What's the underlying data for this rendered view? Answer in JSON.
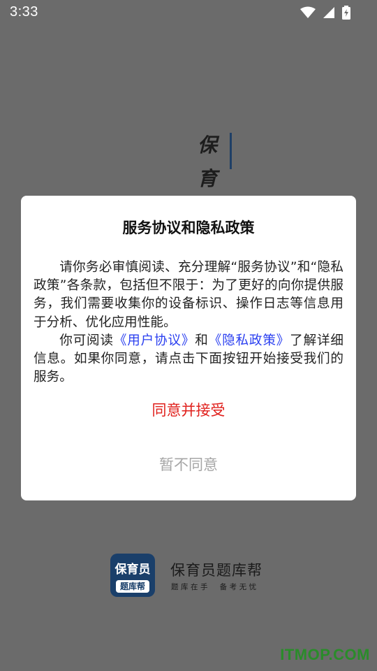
{
  "status_bar": {
    "time": "3:33",
    "icons": [
      "wifi-icon",
      "cellular-signal-icon",
      "battery-charging-icon"
    ]
  },
  "splash": {
    "chars": [
      "保",
      "育"
    ]
  },
  "dialog": {
    "title": "服务协议和隐私政策",
    "paragraph1": "请你务必审慎阅读、充分理解“服务协议”和“隐私政策”各条款，包括但不限于：为了更好的向你提供服务，我们需要收集你的设备标识、操作日志等信息用于分析、优化应用性能。",
    "paragraph2_prefix": "你可阅读",
    "user_agreement_link": "《用户协议》",
    "paragraph2_and": "和",
    "privacy_policy_link": "《隐私政策》",
    "paragraph2_suffix": "了解详细信息。如果你同意，请点击下面按钮开始接受我们的服务。",
    "accept_label": "同意并接受",
    "reject_label": "暂不同意"
  },
  "brand": {
    "logo_top": "保育员",
    "logo_bottom": "题库帮",
    "name": "保育员题库帮",
    "slogan": "题库在手  备考无忧"
  },
  "watermark": "ITMOP.COM",
  "colors": {
    "overlay": "#6b6b6b",
    "accept": "#e0201c",
    "reject": "#a6a6a6",
    "link": "#2a3ff0",
    "brand": "#1a3f6a"
  }
}
